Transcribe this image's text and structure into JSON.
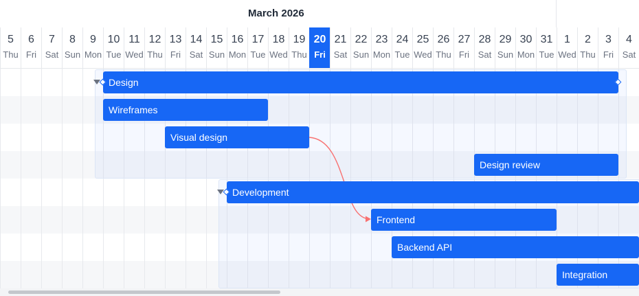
{
  "timeline": {
    "month_label": "March 2026",
    "today_index": 15,
    "days": [
      {
        "num": "5",
        "name": "Thu"
      },
      {
        "num": "6",
        "name": "Fri"
      },
      {
        "num": "7",
        "name": "Sat"
      },
      {
        "num": "8",
        "name": "Sun"
      },
      {
        "num": "9",
        "name": "Mon"
      },
      {
        "num": "10",
        "name": "Tue"
      },
      {
        "num": "11",
        "name": "Wed"
      },
      {
        "num": "12",
        "name": "Thu"
      },
      {
        "num": "13",
        "name": "Fri"
      },
      {
        "num": "14",
        "name": "Sat"
      },
      {
        "num": "15",
        "name": "Sun"
      },
      {
        "num": "16",
        "name": "Mon"
      },
      {
        "num": "17",
        "name": "Tue"
      },
      {
        "num": "18",
        "name": "Wed"
      },
      {
        "num": "19",
        "name": "Thu"
      },
      {
        "num": "20",
        "name": "Fri"
      },
      {
        "num": "21",
        "name": "Sat"
      },
      {
        "num": "22",
        "name": "Sun"
      },
      {
        "num": "23",
        "name": "Mon"
      },
      {
        "num": "24",
        "name": "Tue"
      },
      {
        "num": "25",
        "name": "Wed"
      },
      {
        "num": "26",
        "name": "Thu"
      },
      {
        "num": "27",
        "name": "Fri"
      },
      {
        "num": "28",
        "name": "Sat"
      },
      {
        "num": "29",
        "name": "Sun"
      },
      {
        "num": "30",
        "name": "Mon"
      },
      {
        "num": "31",
        "name": "Tue"
      },
      {
        "num": "1",
        "name": "Wed"
      },
      {
        "num": "2",
        "name": "Thu"
      },
      {
        "num": "3",
        "name": "Fri"
      },
      {
        "num": "4",
        "name": "Sat"
      }
    ]
  },
  "tasks": {
    "design": "Design",
    "wireframes": "Wireframes",
    "visual_design": "Visual design",
    "design_review": "Design review",
    "development": "Development",
    "frontend": "Frontend",
    "backend_api": "Backend API",
    "integration": "Integration"
  },
  "colors": {
    "bar": "#1767f5",
    "today": "#1767f5",
    "dependency_link": "#f87171"
  }
}
